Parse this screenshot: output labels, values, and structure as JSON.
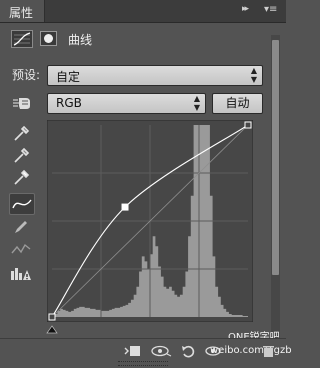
{
  "panel": {
    "tab_label": "属性",
    "tab_close": "×",
    "collapse_glyph": "▸▸",
    "menu_glyph": "▾≡",
    "adjustment_title": "曲线"
  },
  "preset": {
    "label": "预设:",
    "value": "自定"
  },
  "channel": {
    "value": "RGB"
  },
  "auto_button": {
    "label": "自动"
  },
  "tools": [
    "sample-in-image-set-black-point",
    "sample-in-image-set-gray-point",
    "sample-in-image-set-white-point",
    "edit-points-curve",
    "draw-curve-pencil",
    "smooth-curve",
    "show-clipping"
  ],
  "curve": {
    "points": [
      [
        0,
        0
      ],
      [
        95,
        146
      ],
      [
        255,
        255
      ]
    ],
    "input_range": [
      0,
      255
    ],
    "output_range": [
      0,
      255
    ]
  },
  "histogram": {
    "bins": [
      0,
      3,
      6,
      8,
      7,
      6,
      5,
      6,
      8,
      9,
      10,
      10,
      9,
      9,
      8,
      8,
      7,
      7,
      6,
      6,
      6,
      7,
      8,
      9,
      9,
      10,
      11,
      12,
      14,
      17,
      22,
      30,
      45,
      60,
      55,
      48,
      62,
      80,
      70,
      50,
      40,
      30,
      28,
      30,
      26,
      22,
      20,
      22,
      30,
      45,
      80,
      120,
      190,
      190,
      190,
      190,
      190,
      190,
      120,
      60,
      30,
      20,
      12,
      8,
      5,
      3,
      2,
      2,
      2,
      2,
      1,
      1
    ]
  },
  "watermark": {
    "line1": "ONE锐字吧",
    "line2": "weibo.com/1gzb"
  },
  "colors": {
    "panel_bg": "#535353",
    "graph_bg": "#474747",
    "histogram": "#9a9a9a",
    "curve": "#ffffff"
  }
}
